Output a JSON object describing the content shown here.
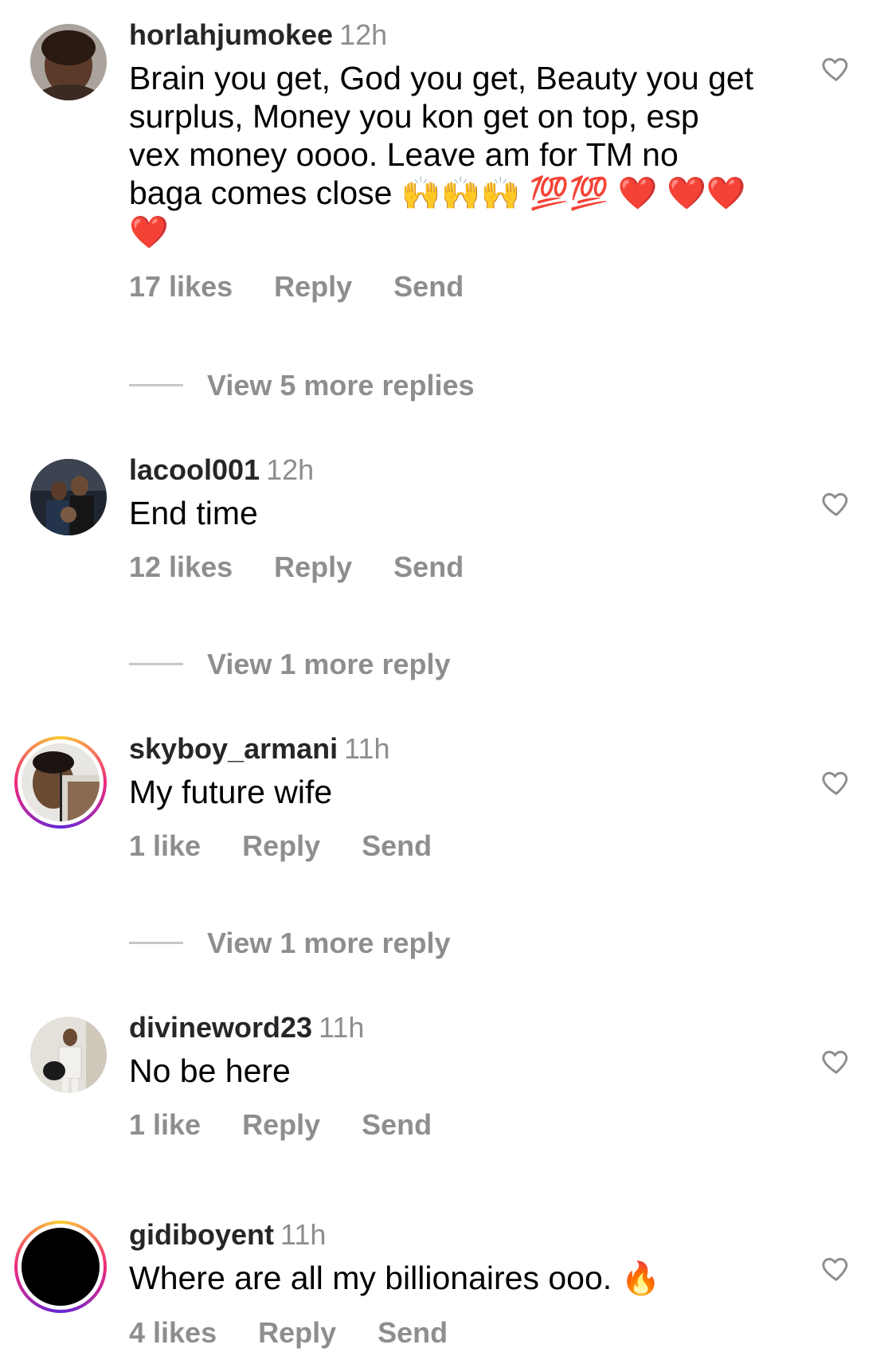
{
  "comments": [
    {
      "username": "horlahjumokee",
      "time": "12h",
      "text": "Brain you get, God you get, Beauty you get surplus, Money you kon get on top, esp vex money oooo. Leave am for TM no baga comes close",
      "emoji_tail": [
        "🙌",
        "🙌",
        "🙌",
        "💯",
        "💯",
        "❤️",
        "❤️",
        "❤️",
        "❤️"
      ],
      "likes": "17 likes",
      "reply": "Reply",
      "send": "Send",
      "view_more": "View 5 more replies",
      "avatar_color": "#5b3a2a",
      "has_story_ring": false
    },
    {
      "username": "lacool001",
      "time": "12h",
      "text": "End time",
      "likes": "12 likes",
      "reply": "Reply",
      "send": "Send",
      "view_more": "View 1 more reply",
      "avatar_color": "#2b3340",
      "has_story_ring": false
    },
    {
      "username": "skyboy_armani",
      "time": "11h",
      "text": "My future wife",
      "likes": "1 like",
      "reply": "Reply",
      "send": "Send",
      "view_more": "View 1 more reply",
      "avatar_color": "#6b4a33",
      "has_story_ring": true
    },
    {
      "username": "divineword23",
      "time": "11h",
      "text": "No be here",
      "likes": "1 like",
      "reply": "Reply",
      "send": "Send",
      "avatar_color": "#d8d2c6",
      "has_story_ring": false
    },
    {
      "username": "gidiboyent",
      "time": "11h",
      "text": "Where are all my billionaires ooo.",
      "emoji_tail": [
        "🔥"
      ],
      "likes": "4 likes",
      "reply": "Reply",
      "send": "Send",
      "avatar_color": "#000000",
      "has_story_ring": true
    }
  ],
  "icons": {
    "like": "heart-outline-icon"
  },
  "colors": {
    "username": "#262626",
    "meta": "#8e8e8e",
    "divider": "#c7c7c7",
    "story_ring_start": "#f9ce34",
    "story_ring_end": "#ee2a7b"
  }
}
